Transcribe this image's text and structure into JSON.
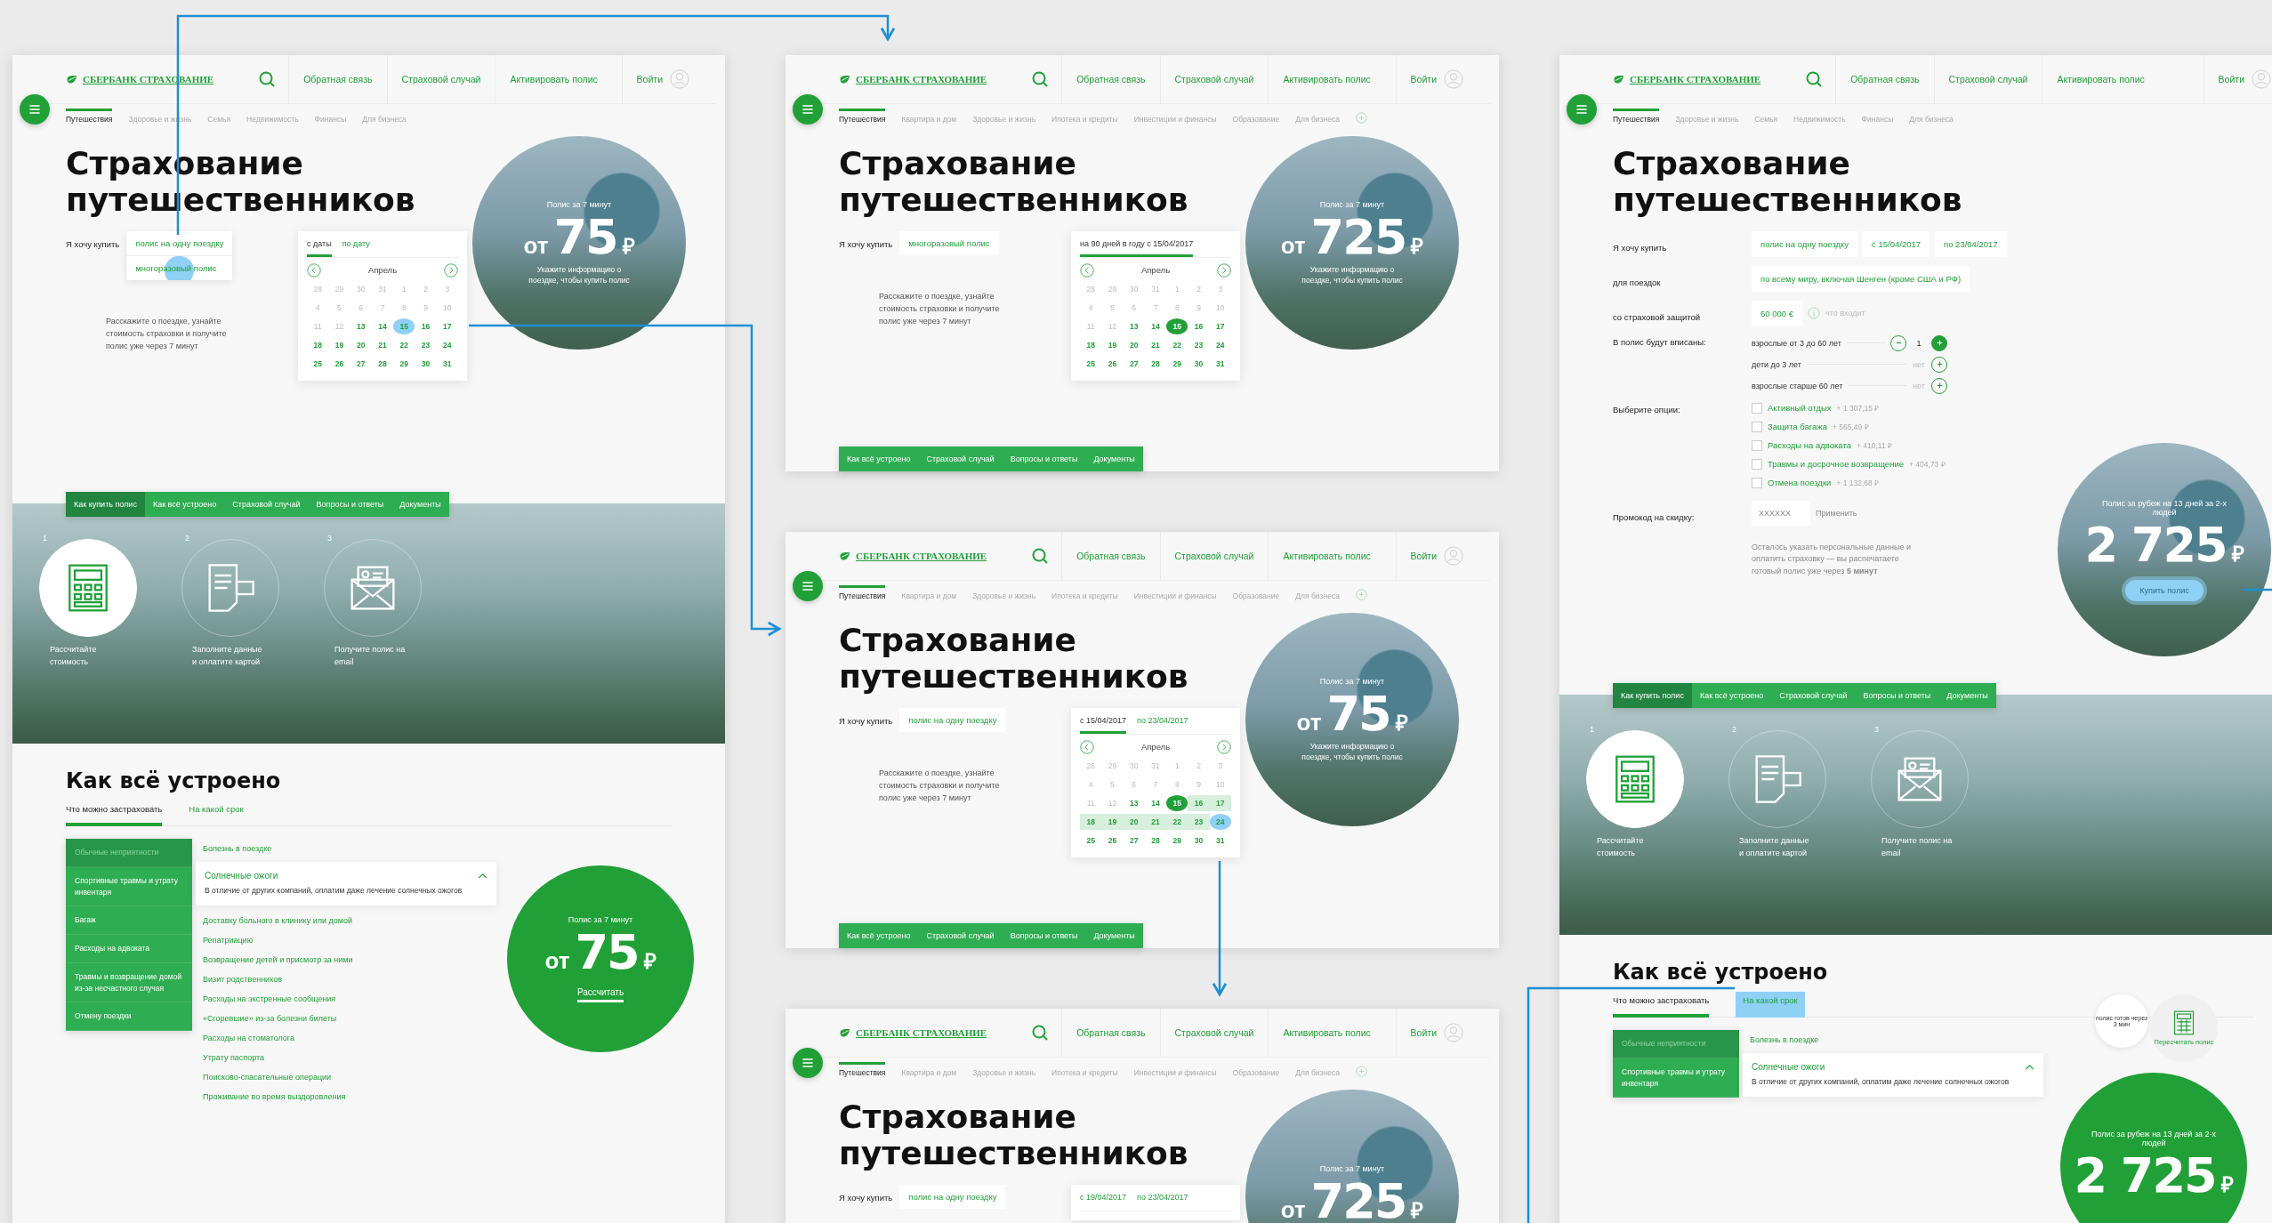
{
  "columns": [
    {
      "screens": [
        {
          "header": {
            "logo": "СБЕРБАНК СТРАХОВАНИЕ",
            "nav": [
              "Обратная связь",
              "Страховой случай",
              "Активировать полис"
            ],
            "login": "Войти"
          },
          "categories": {
            "items": [
              {
                "label": "Путешествия",
                "selected": true
              },
              {
                "label": "Здоровье и жизнь",
                "selected": false
              },
              {
                "label": "Семья",
                "selected": false
              },
              {
                "label": "Недвижимость",
                "selected": false
              },
              {
                "label": "Финансы",
                "selected": false
              },
              {
                "label": "Для бизнеса",
                "selected": false
              }
            ]
          },
          "hero": {
            "kind": "quick",
            "title": "Страхование путешественников",
            "label": "Я хочу купить",
            "choice": "полис на одну поездку",
            "options": [
              {
                "label": "многоразовый полис",
                "touched": true
              }
            ],
            "calendar": {
              "tabs": [
                {
                  "label": "с даты",
                  "selected": true
                },
                {
                  "label": "по дату",
                  "selected": false
                }
              ],
              "month": "Апрель",
              "days": [
                {
                  "day": "28",
                  "kind": "muted",
                  "selected": false
                },
                {
                  "day": "29",
                  "kind": "muted",
                  "selected": false
                },
                {
                  "day": "30",
                  "kind": "muted",
                  "selected": false
                },
                {
                  "day": "31",
                  "kind": "muted",
                  "selected": false
                },
                {
                  "day": "1",
                  "kind": "muted",
                  "selected": false
                },
                {
                  "day": "2",
                  "kind": "muted",
                  "selected": false
                },
                {
                  "day": "3",
                  "kind": "muted",
                  "selected": false
                },
                {
                  "day": "4",
                  "kind": "muted",
                  "selected": false
                },
                {
                  "day": "5",
                  "kind": "muted",
                  "selected": false
                },
                {
                  "day": "6",
                  "kind": "muted",
                  "selected": false
                },
                {
                  "day": "7",
                  "kind": "muted",
                  "selected": false
                },
                {
                  "day": "8",
                  "kind": "muted",
                  "selected": false
                },
                {
                  "day": "9",
                  "kind": "muted",
                  "selected": false
                },
                {
                  "day": "10",
                  "kind": "muted",
                  "selected": false
                },
                {
                  "day": "11",
                  "kind": "muted",
                  "selected": false
                },
                {
                  "day": "12",
                  "kind": "muted",
                  "selected": false
                },
                {
                  "day": "13",
                  "kind": "open",
                  "selected": false
                },
                {
                  "day": "14",
                  "kind": "open",
                  "selected": false
                },
                {
                  "day": "15",
                  "kind": "touch",
                  "selected": false
                },
                {
                  "day": "16",
                  "kind": "open",
                  "selected": false
                },
                {
                  "day": "17",
                  "kind": "open",
                  "selected": false
                },
                {
                  "day": "18",
                  "kind": "open",
                  "selected": false
                },
                {
                  "day": "19",
                  "kind": "open",
                  "selected": false
                },
                {
                  "day": "20",
                  "kind": "open",
                  "selected": false
                },
                {
                  "day": "21",
                  "kind": "open",
                  "selected": false
                },
                {
                  "day": "22",
                  "kind": "open",
                  "selected": false
                },
                {
                  "day": "23",
                  "kind": "open",
                  "selected": false
                },
                {
                  "day": "24",
                  "kind": "open",
                  "selected": false
                },
                {
                  "day": "25",
                  "kind": "open",
                  "selected": false
                },
                {
                  "day": "26",
                  "kind": "open",
                  "selected": false
                },
                {
                  "day": "27",
                  "kind": "open",
                  "selected": false
                },
                {
                  "day": "28",
                  "kind": "open",
                  "selected": false
                },
                {
                  "day": "29",
                  "kind": "open",
                  "selected": false
                },
                {
                  "day": "30",
                  "kind": "open",
                  "selected": false
                },
                {
                  "day": "31",
                  "kind": "open",
                  "selected": false
                }
              ]
            },
            "description": "Расскажите о поездке, узнайте стоимость страховки и получите полис уже через 7 минут",
            "price": {
              "kind": "photo",
              "caption": "Полис за 7 минут",
              "prefix": "от",
              "amount": "75",
              "currency": "₽",
              "note": "Укажите информацию о поездке, чтобы купить полис"
            }
          },
          "tabs": [
            {
              "label": "Как купить полис",
              "selected": true
            },
            {
              "label": "Как всё устроено",
              "selected": false
            },
            {
              "label": "Страховой случай",
              "selected": false
            },
            {
              "label": "Вопросы и ответы",
              "selected": false
            },
            {
              "label": "Документы",
              "selected": false
            }
          ],
          "steps": [
            {
              "number": "1",
              "kind": "calculator",
              "caption": "Рассчитайте стоимость",
              "selected": true
            },
            {
              "number": "2",
              "kind": "document",
              "caption": "Заполните данные и оплатите картой",
              "selected": false
            },
            {
              "number": "3",
              "kind": "envelope",
              "caption": "Получите полис на email",
              "selected": false
            }
          ],
          "how": {
            "title": "Как всё устроено",
            "tabs": [
              {
                "label": "Что можно застраховать",
                "selected": true,
                "touched": false
              },
              {
                "label": "На какой срок",
                "selected": false,
                "touched": false
              }
            ],
            "topics": [
              {
                "label": "Обычные неприятности",
                "selected": true
              },
              {
                "label": "Спортивные травмы и утрату инвентаря",
                "selected": false
              },
              {
                "label": "Багаж",
                "selected": false
              },
              {
                "label": "Расходы на адвоката",
                "selected": false
              },
              {
                "label": "Травмы и возвращение домой из-за несчастного случая",
                "selected": false
              },
              {
                "label": "Отмену поездки",
                "selected": false
              }
            ],
            "items": [
              {
                "label": "Болезнь в поездке",
                "expanded": false
              },
              {
                "label": "Солнечные ожоги",
                "expanded": true,
                "text": "В отличие от других компаний, оплатим даже лечение солнечных ожогов"
              },
              {
                "label": "Доставку больного в клинику или домой",
                "expanded": false
              },
              {
                "label": "Репатриацию",
                "expanded": false
              },
              {
                "label": "Возвращение детей и присмотр за ними",
                "expanded": false
              },
              {
                "label": "Визит родственников",
                "expanded": false
              },
              {
                "label": "Расходы на экстренные сообщения",
                "expanded": false
              },
              {
                "label": "«Сгоревшие» из-за болезни билеты",
                "expanded": false
              },
              {
                "label": "Расходы на стоматолога",
                "expanded": false
              },
              {
                "label": "Утрату паспорта",
                "expanded": false
              },
              {
                "label": "Поисково-спасательные операции",
                "expanded": false
              },
              {
                "label": "Проживание во время выздоровления",
                "expanded": false
              }
            ],
            "price": {
              "kind": "green",
              "caption": "Полис за 7 минут",
              "prefix": "от",
              "amount": "75",
              "currency": "₽",
              "button": "Рассчитать"
            }
          }
        }
      ]
    },
    {
      "screens": [
        {
          "header": {
            "logo": "СБЕРБАНК СТРАХОВАНИЕ",
            "nav": [
              "Обратная связь",
              "Страховой случай",
              "Активировать полис"
            ],
            "login": "Войти"
          },
          "categories": {
            "items": [
              {
                "label": "Путешествия",
                "selected": true
              },
              {
                "label": "Квартира и дом",
                "selected": false
              },
              {
                "label": "Здоровье и жизнь",
                "selected": false
              },
              {
                "label": "Ипотека и кредиты",
                "selected": false
              },
              {
                "label": "Инвестиции и финансы",
                "selected": false
              },
              {
                "label": "Образование",
                "selected": false
              },
              {
                "label": "Для бизнеса",
                "selected": false
              }
            ],
            "more": true
          },
          "hero": {
            "kind": "quick",
            "title": "Страхование путешественников",
            "label": "Я хочу купить",
            "choice": "многоразовый полис",
            "calendar": {
              "tabs": [
                {
                  "label": "на 90 дней в году с 15/04/2017",
                  "selected": true
                }
              ],
              "month": "Апрель",
              "days": [
                {
                  "day": "28",
                  "kind": "muted",
                  "selected": false
                },
                {
                  "day": "29",
                  "kind": "muted",
                  "selected": false
                },
                {
                  "day": "30",
                  "kind": "muted",
                  "selected": false
                },
                {
                  "day": "31",
                  "kind": "muted",
                  "selected": false
                },
                {
                  "day": "1",
                  "kind": "muted",
                  "selected": false
                },
                {
                  "day": "2",
                  "kind": "muted",
                  "selected": false
                },
                {
                  "day": "3",
                  "kind": "muted",
                  "selected": false
                },
                {
                  "day": "4",
                  "kind": "muted",
                  "selected": false
                },
                {
                  "day": "5",
                  "kind": "muted",
                  "selected": false
                },
                {
                  "day": "6",
                  "kind": "muted",
                  "selected": false
                },
                {
                  "day": "7",
                  "kind": "muted",
                  "selected": false
                },
                {
                  "day": "8",
                  "kind": "muted",
                  "selected": false
                },
                {
                  "day": "9",
                  "kind": "muted",
                  "selected": false
                },
                {
                  "day": "10",
                  "kind": "muted",
                  "selected": false
                },
                {
                  "day": "11",
                  "kind": "muted",
                  "selected": false
                },
                {
                  "day": "12",
                  "kind": "muted",
                  "selected": false
                },
                {
                  "day": "13",
                  "kind": "open",
                  "selected": false
                },
                {
                  "day": "14",
                  "kind": "open",
                  "selected": false
                },
                {
                  "day": "15",
                  "kind": "open",
                  "selected": true
                },
                {
                  "day": "16",
                  "kind": "open",
                  "selected": false
                },
                {
                  "day": "17",
                  "kind": "open",
                  "selected": false
                },
                {
                  "day": "18",
                  "kind": "open",
                  "selected": false
                },
                {
                  "day": "19",
                  "kind": "open",
                  "selected": false
                },
                {
                  "day": "20",
                  "kind": "open",
                  "selected": false
                },
                {
                  "day": "21",
                  "kind": "open",
                  "selected": false
                },
                {
                  "day": "22",
                  "kind": "open",
                  "selected": false
                },
                {
                  "day": "23",
                  "kind": "open",
                  "selected": false
                },
                {
                  "day": "24",
                  "kind": "open",
                  "selected": false
                },
                {
                  "day": "25",
                  "kind": "open",
                  "selected": false
                },
                {
                  "day": "26",
                  "kind": "open",
                  "selected": false
                },
                {
                  "day": "27",
                  "kind": "open",
                  "selected": false
                },
                {
                  "day": "28",
                  "kind": "open",
                  "selected": false
                },
                {
                  "day": "29",
                  "kind": "open",
                  "selected": false
                },
                {
                  "day": "30",
                  "kind": "open",
                  "selected": false
                },
                {
                  "day": "31",
                  "kind": "open",
                  "selected": false
                }
              ]
            },
            "description": "Расскажите о поездке, узнайте стоимость страховки и получите полис уже через 7 минут",
            "price": {
              "kind": "photo",
              "caption": "Полис за 7 минут",
              "prefix": "от",
              "amount": "725",
              "currency": "₽",
              "note": "Укажите информацию о поездке, чтобы купить полис"
            }
          },
          "tabs": [
            {
              "label": "Как всё устроено",
              "selected": false
            },
            {
              "label": "Страховой случай",
              "selected": false
            },
            {
              "label": "Вопросы и ответы",
              "selected": false
            },
            {
              "label": "Документы",
              "selected": false
            }
          ]
        },
        {
          "header": {
            "logo": "СБЕРБАНК СТРАХОВАНИЕ",
            "nav": [
              "Обратная связь",
              "Страховой случай",
              "Активировать полис"
            ],
            "login": "Войти"
          },
          "categories": {
            "items": [
              {
                "label": "Путешествия",
                "selected": true
              },
              {
                "label": "Квартира и дом",
                "selected": false
              },
              {
                "label": "Здоровье и жизнь",
                "selected": false
              },
              {
                "label": "Ипотека и кредиты",
                "selected": false
              },
              {
                "label": "Инвестиции и финансы",
                "selected": false
              },
              {
                "label": "Образование",
                "selected": false
              },
              {
                "label": "Для бизнеса",
                "selected": false
              }
            ],
            "more": true
          },
          "hero": {
            "kind": "quick",
            "title": "Страхование путешественников",
            "label": "Я хочу купить",
            "choice": "полис на одну поездку",
            "calendar": {
              "tabs": [
                {
                  "label": "с 15/04/2017",
                  "selected": true
                },
                {
                  "label": "по 23/04/2017",
                  "selected": false
                }
              ],
              "month": "Апрель",
              "days": [
                {
                  "day": "28",
                  "kind": "muted",
                  "selected": false
                },
                {
                  "day": "29",
                  "kind": "muted",
                  "selected": false
                },
                {
                  "day": "30",
                  "kind": "muted",
                  "selected": false
                },
                {
                  "day": "31",
                  "kind": "muted",
                  "selected": false
                },
                {
                  "day": "1",
                  "kind": "muted",
                  "selected": false
                },
                {
                  "day": "2",
                  "kind": "muted",
                  "selected": false
                },
                {
                  "day": "3",
                  "kind": "muted",
                  "selected": false
                },
                {
                  "day": "4",
                  "kind": "muted",
                  "selected": false
                },
                {
                  "day": "5",
                  "kind": "muted",
                  "selected": false
                },
                {
                  "day": "6",
                  "kind": "muted",
                  "selected": false
                },
                {
                  "day": "7",
                  "kind": "muted",
                  "selected": false
                },
                {
                  "day": "8",
                  "kind": "muted",
                  "selected": false
                },
                {
                  "day": "9",
                  "kind": "muted",
                  "selected": false
                },
                {
                  "day": "10",
                  "kind": "muted",
                  "selected": false
                },
                {
                  "day": "11",
                  "kind": "muted",
                  "selected": false
                },
                {
                  "day": "12",
                  "kind": "muted",
                  "selected": false
                },
                {
                  "day": "13",
                  "kind": "open",
                  "selected": false
                },
                {
                  "day": "14",
                  "kind": "open",
                  "selected": false
                },
                {
                  "day": "15",
                  "kind": "open",
                  "selected": true
                },
                {
                  "day": "16",
                  "kind": "range",
                  "selected": false
                },
                {
                  "day": "17",
                  "kind": "range",
                  "selected": false
                },
                {
                  "day": "18",
                  "kind": "range",
                  "selected": false
                },
                {
                  "day": "19",
                  "kind": "range",
                  "selected": false
                },
                {
                  "day": "20",
                  "kind": "range",
                  "selected": false
                },
                {
                  "day": "21",
                  "kind": "range",
                  "selected": false
                },
                {
                  "day": "22",
                  "kind": "range",
                  "selected": false
                },
                {
                  "day": "23",
                  "kind": "range",
                  "selected": false
                },
                {
                  "day": "24",
                  "kind": "touch",
                  "selected": false
                },
                {
                  "day": "25",
                  "kind": "open",
                  "selected": false
                },
                {
                  "day": "26",
                  "kind": "open",
                  "selected": false
                },
                {
                  "day": "27",
                  "kind": "open",
                  "selected": false
                },
                {
                  "day": "28",
                  "kind": "open",
                  "selected": false
                },
                {
                  "day": "29",
                  "kind": "open",
                  "selected": false
                },
                {
                  "day": "30",
                  "kind": "open",
                  "selected": false
                },
                {
                  "day": "31",
                  "kind": "open",
                  "selected": false
                }
              ]
            },
            "description": "Расскажите о поездке, узнайте стоимость страховки и получите полис уже через 7 минут",
            "price": {
              "kind": "photo",
              "caption": "Полис за 7 минут",
              "prefix": "от",
              "amount": "75",
              "currency": "₽",
              "note": "Укажите информацию о поездке, чтобы купить полис"
            }
          },
          "tabs": [
            {
              "label": "Как всё устроено",
              "selected": false
            },
            {
              "label": "Страховой случай",
              "selected": false
            },
            {
              "label": "Вопросы и ответы",
              "selected": false
            },
            {
              "label": "Документы",
              "selected": false
            }
          ]
        },
        {
          "header": {
            "logo": "СБЕРБАНК СТРАХОВАНИЕ",
            "nav": [
              "Обратная связь",
              "Страховой случай",
              "Активировать полис"
            ],
            "login": "Войти"
          },
          "categories": {
            "items": [
              {
                "label": "Путешествия",
                "selected": true
              },
              {
                "label": "Квартира и дом",
                "selected": false
              },
              {
                "label": "Здоровье и жизнь",
                "selected": false
              },
              {
                "label": "Ипотека и кредиты",
                "selected": false
              },
              {
                "label": "Инвестиции и финансы",
                "selected": false
              },
              {
                "label": "Образование",
                "selected": false
              },
              {
                "label": "Для бизнеса",
                "selected": false
              }
            ],
            "more": true
          },
          "hero": {
            "kind": "quick",
            "title": "Страхование путешественников",
            "label": "Я хочу купить",
            "choice": "полис на одну поездку",
            "calendar": {
              "tabs": [
                {
                  "label": "с 19/04/2017",
                  "selected": false
                },
                {
                  "label": "по 23/04/2017",
                  "selected": false
                }
              ]
            },
            "price": {
              "kind": "photo",
              "caption": "Полис за 7 минут",
              "prefix": "от",
              "amount": "725",
              "currency": "₽"
            }
          }
        }
      ]
    },
    {
      "screens": [
        {
          "header": {
            "logo": "СБЕРБАНК СТРАХОВАНИЕ",
            "nav": [
              "Обратная связь",
              "Страховой случай",
              "Активировать полис"
            ],
            "login": "Войти"
          },
          "categories": {
            "items": [
              {
                "label": "Путешествия",
                "selected": true
              },
              {
                "label": "Здоровье и жизнь",
                "selected": false
              },
              {
                "label": "Семья",
                "selected": false
              },
              {
                "label": "Недвижимость",
                "selected": false
              },
              {
                "label": "Финансы",
                "selected": false
              },
              {
                "label": "Для бизнеса",
                "selected": false
              }
            ]
          },
          "hero": {
            "kind": "full",
            "title": "Страхование путешественников",
            "rows": [
              {
                "kind": "choice",
                "label": "Я хочу купить",
                "fields": [
                  "полис на одну поездку",
                  "с 15/04/2017",
                  "по 23/04/2017"
                ]
              },
              {
                "kind": "choice",
                "label": "для поездок",
                "fields": [
                  "по всему миру, включая Шенген (кроме США и РФ)"
                ]
              },
              {
                "kind": "coverage",
                "label": "со страховой защитой",
                "fields": [
                  "60 000 €"
                ],
                "hint": "что входит"
              },
              {
                "kind": "people",
                "label": "В полис будут вписаны:",
                "people": [
                  {
                    "label": "взрослые от 3 до 60 лет",
                    "count": "1",
                    "removable": true
                  },
                  {
                    "label": "дети до 3 лет",
                    "count": "нет"
                  },
                  {
                    "label": "взрослые старше 60 лет",
                    "count": "нет"
                  }
                ]
              },
              {
                "kind": "options",
                "label": "Выберите опции:",
                "options": [
                  {
                    "label": "Активный отдых",
                    "price": "+ 1 307,15 ₽",
                    "checked": false
                  },
                  {
                    "label": "Защита багажа",
                    "price": "+ 565,49 ₽",
                    "checked": false
                  },
                  {
                    "label": "Расходы на адвоката",
                    "price": "+ 410,11 ₽",
                    "checked": false
                  },
                  {
                    "label": "Травмы и досрочное возвращение",
                    "price": "+ 404,73 ₽",
                    "checked": false
                  },
                  {
                    "label": "Отмена поездки",
                    "price": "+ 1 132,68 ₽",
                    "checked": false
                  }
                ]
              },
              {
                "kind": "promo",
                "label": "Промокод на скидку:",
                "placeholder": "XXXXXX",
                "button": "Применить"
              },
              {
                "kind": "note",
                "text": "Осталось указать персональные данные и оплатить страховку — вы распечатаете готовый полис уже через **5 минут**"
              }
            ],
            "price": {
              "kind": "photo",
              "caption": "Полис за рубеж на 13 дней за 2-х людей",
              "amount": "2 725",
              "currency": "₽",
              "button": "Купить полис",
              "button_touched": true
            }
          },
          "tabs": [
            {
              "label": "Как купить полис",
              "selected": true
            },
            {
              "label": "Как всё устроено",
              "selected": false
            },
            {
              "label": "Страховой случай",
              "selected": false
            },
            {
              "label": "Вопросы и ответы",
              "selected": false
            },
            {
              "label": "Документы",
              "selected": false
            }
          ],
          "steps": [
            {
              "number": "1",
              "kind": "calculator",
              "caption": "Рассчитайте стоимость",
              "selected": true
            },
            {
              "number": "2",
              "kind": "document",
              "caption": "Заполните данные и оплатите картой",
              "selected": false
            },
            {
              "number": "3",
              "kind": "envelope",
              "caption": "Получите полис на email",
              "selected": false
            }
          ],
          "how": {
            "title": "Как всё устроено",
            "tabs": [
              {
                "label": "Что можно застраховать",
                "selected": true,
                "touched": false
              },
              {
                "label": "На какой срок",
                "selected": false,
                "touched": true
              }
            ],
            "topics": [
              {
                "label": "Обычные неприятности",
                "selected": true
              },
              {
                "label": "Спортивные травмы и утрату инвентаря",
                "selected": false
              }
            ],
            "items": [
              {
                "label": "Болезнь в поездке",
                "expanded": false
              },
              {
                "label": "Солнечные ожоги",
                "expanded": true,
                "text": "В отличие от других компаний, оплатим даже лечение солнечных ожогов"
              }
            ],
            "recalc": {
              "badge": "полис готов через 3 мин",
              "label": "Пересчитать полис"
            },
            "price": {
              "kind": "green",
              "caption": "Полис за рубеж на 13 дней за 2-х людей",
              "amount": "2 725",
              "currency": "₽"
            }
          }
        }
      ]
    }
  ]
}
